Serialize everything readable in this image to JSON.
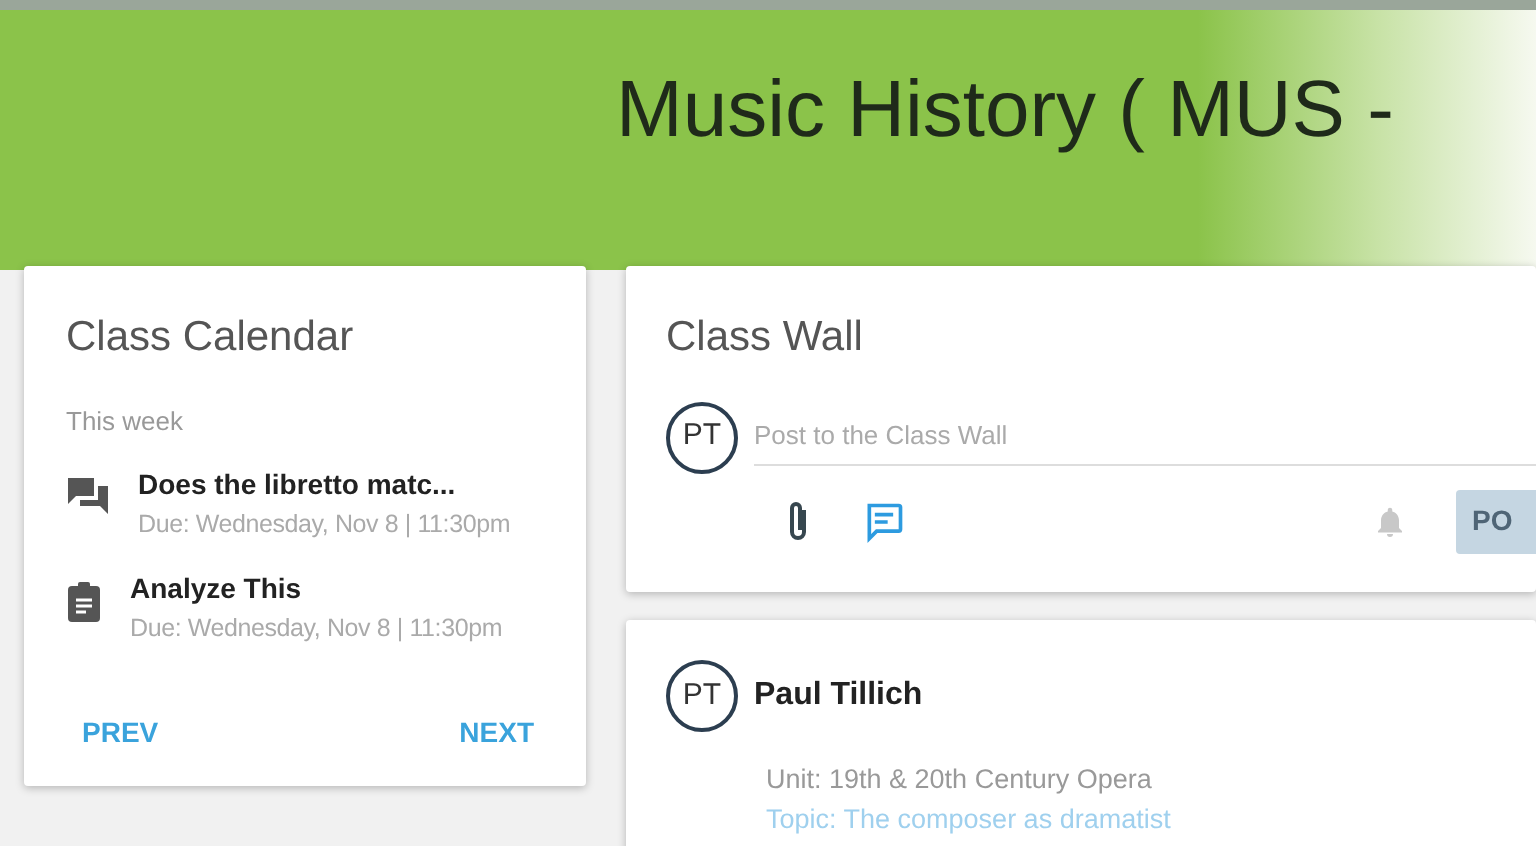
{
  "header": {
    "title": "Music History ( MUS -"
  },
  "calendar": {
    "title": "Class Calendar",
    "section": "This week",
    "items": [
      {
        "kind": "discussion",
        "title": "Does the libretto matc...",
        "due": "Due: Wednesday, Nov 8 | 11:30pm"
      },
      {
        "kind": "assignment",
        "title": "Analyze This",
        "due": "Due: Wednesday, Nov 8 | 11:30pm"
      }
    ],
    "prev": "PREV",
    "next": "NEXT"
  },
  "wall": {
    "title": "Class Wall",
    "avatar": "PT",
    "placeholder": "Post to the Class Wall",
    "post_button": {
      "label": "PO",
      "disabled": true
    }
  },
  "posts": [
    {
      "avatar": "PT",
      "author": "Paul Tillich",
      "unit": "Unit: 19th & 20th Century Opera",
      "topic": "Topic: The composer as dramatist"
    }
  ]
}
